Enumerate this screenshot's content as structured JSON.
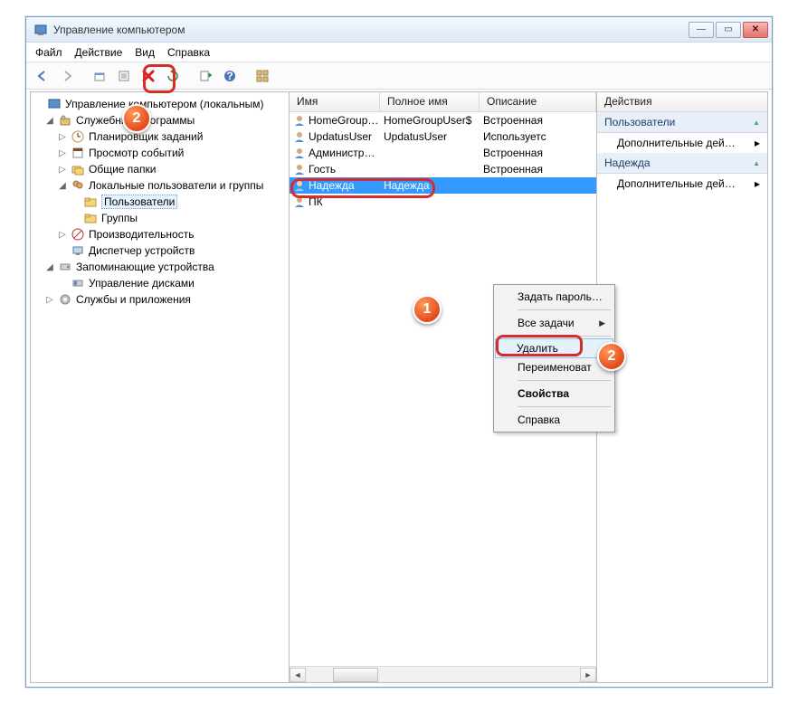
{
  "window": {
    "title": "Управление компьютером"
  },
  "menubar": [
    "Файл",
    "Действие",
    "Вид",
    "Справка"
  ],
  "toolbar_icons": [
    "back",
    "forward",
    "up",
    "props",
    "delete",
    "refresh",
    "export",
    "help",
    "grid"
  ],
  "tree": {
    "root": "Управление компьютером (локальным)",
    "services_tools": "Служебные программы",
    "task_scheduler": "Планировщик заданий",
    "event_viewer": "Просмотр событий",
    "shared_folders": "Общие папки",
    "local_users": "Локальные пользователи и группы",
    "users": "Пользователи",
    "groups": "Группы",
    "performance": "Производительность",
    "device_manager": "Диспетчер устройств",
    "storage": "Запоминающие устройства",
    "disk_mgmt": "Управление дисками",
    "services_apps": "Службы и приложения"
  },
  "list": {
    "columns": {
      "name": "Имя",
      "fullname": "Полное имя",
      "desc": "Описание"
    },
    "rows": [
      {
        "name": "HomeGroup…",
        "fullname": "HomeGroupUser$",
        "desc": "Встроенная"
      },
      {
        "name": "UpdatusUser",
        "fullname": "UpdatusUser",
        "desc": "Используетс"
      },
      {
        "name": "Администр…",
        "fullname": "",
        "desc": "Встроенная"
      },
      {
        "name": "Гость",
        "fullname": "",
        "desc": "Встроенная"
      },
      {
        "name": "Надежда",
        "fullname": "Надежда",
        "desc": "",
        "selected": true
      },
      {
        "name": "ПК",
        "fullname": "",
        "desc": ""
      }
    ]
  },
  "actions": {
    "header": "Действия",
    "section1": "Пользователи",
    "item1": "Дополнительные дей…",
    "section2": "Надежда",
    "item2": "Дополнительные дей…"
  },
  "context_menu": {
    "set_password": "Задать пароль…",
    "all_tasks": "Все задачи",
    "delete": "Удалить",
    "rename": "Переименоват",
    "properties": "Свойства",
    "help": "Справка"
  },
  "badges": {
    "one": "1",
    "two": "2"
  }
}
